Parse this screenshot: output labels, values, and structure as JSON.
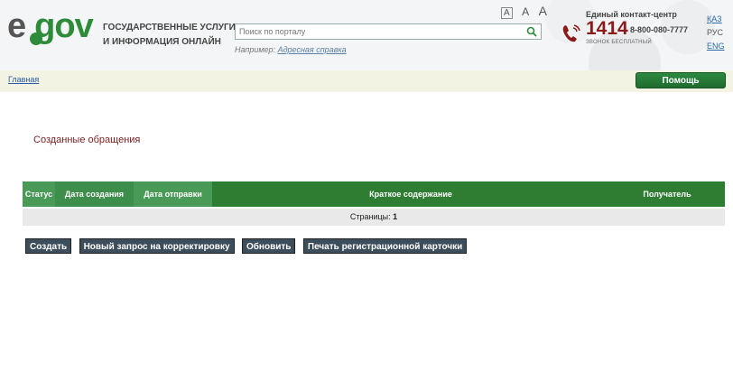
{
  "header": {
    "logo": "e.gov",
    "portal_title": "Государственные услуги и информация онлайн",
    "search": {
      "placeholder": "Поиск по порталу",
      "example_prefix": "Например:",
      "example_link": "Адресная справка"
    },
    "font_sizes": [
      "A",
      "A",
      "A"
    ],
    "contact": {
      "title": "Единый контакт-центр",
      "number": "1414",
      "alt_number": "8-800-080-7777",
      "free_call": "звонок бесплатный"
    },
    "languages": [
      "ҚАЗ",
      "РУС",
      "ENG"
    ],
    "colors": {
      "brand": "#2e8b3a",
      "contact": "#8b1a1a",
      "link": "#2a6aa8"
    }
  },
  "breadcrumb": {
    "home": "Главная",
    "help_button": "Помощь"
  },
  "main": {
    "title": "Созданные обращения",
    "table": {
      "columns": [
        "Статус",
        "Дата создания",
        "Дата отправки",
        "Краткое содержание",
        "Получатель"
      ],
      "pager_label": "Страницы:",
      "pager_value": "1"
    },
    "actions": {
      "create": "Создать",
      "new_correction": "Новый запрос на корректировку",
      "refresh": "Обновить",
      "print_card": "Печать регистрационной карточки"
    }
  }
}
